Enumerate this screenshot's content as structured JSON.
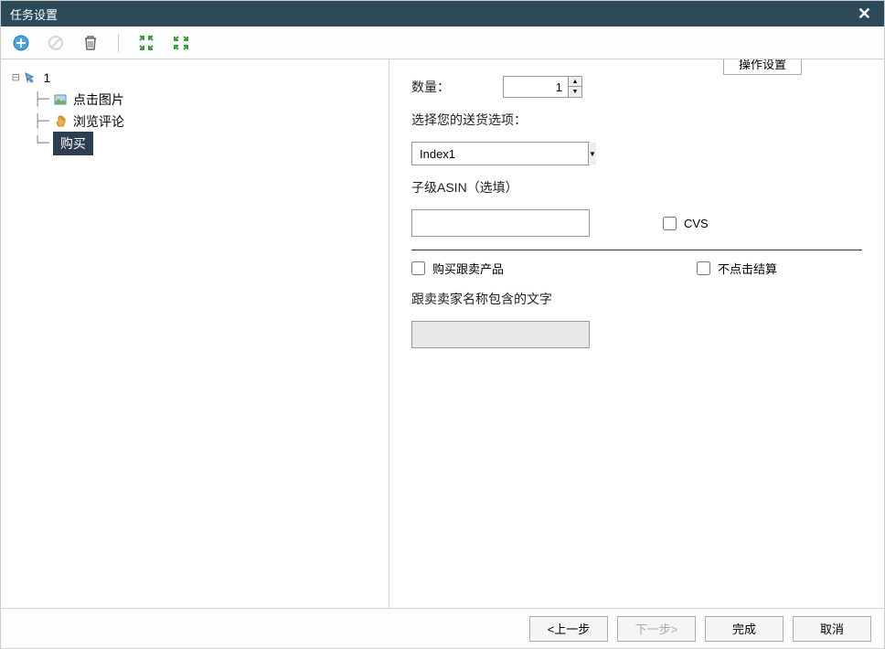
{
  "window": {
    "title": "任务设置"
  },
  "tree": {
    "root": {
      "label": "1"
    },
    "items": [
      {
        "label": "点击图片"
      },
      {
        "label": "浏览评论"
      },
      {
        "label": "购买",
        "selected": true
      }
    ]
  },
  "panel": {
    "legend": "操作设置",
    "quantity_label": "数量：",
    "quantity_value": "1",
    "shipping_label": "选择您的送货选项：",
    "shipping_value": "Index1",
    "asin_label": "子级ASIN（选填）",
    "asin_value": "",
    "cvs_label": "CVS",
    "followsell_label": "购买跟卖产品",
    "nocheckout_label": "不点击结算",
    "sellername_label": "跟卖卖家名称包含的文字",
    "sellername_value": ""
  },
  "footer": {
    "prev": "<上一步",
    "next": "下一步>",
    "finish": "完成",
    "cancel": "取消"
  }
}
